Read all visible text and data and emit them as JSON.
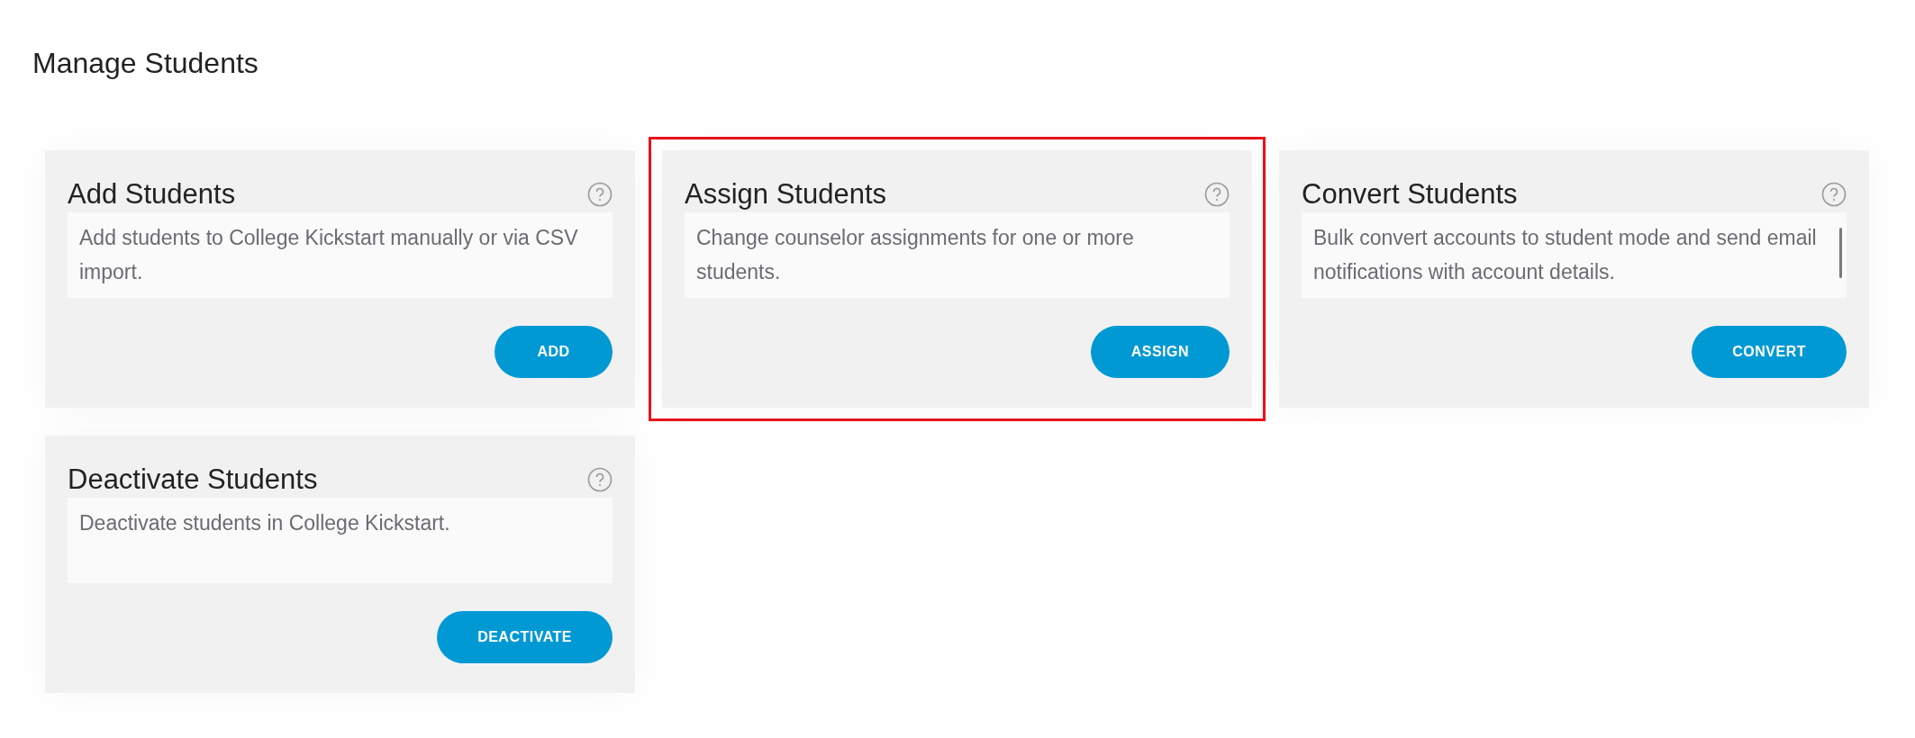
{
  "page_title": "Manage Students",
  "cards": [
    {
      "title": "Add Students",
      "description": "Add students to College Kickstart manually or via CSV import.",
      "button": "ADD",
      "highlighted": false,
      "scrollbar": false
    },
    {
      "title": "Assign Students",
      "description": "Change counselor assignments for one or more students.",
      "button": "ASSIGN",
      "highlighted": true,
      "scrollbar": false
    },
    {
      "title": "Convert Students",
      "description": "Bulk convert accounts to student mode and send email notifications with account details.",
      "button": "CONVERT",
      "highlighted": false,
      "scrollbar": true
    },
    {
      "title": "Deactivate Students",
      "description": "Deactivate students in College Kickstart.",
      "button": "DEACTIVATE",
      "highlighted": false,
      "scrollbar": false
    }
  ]
}
